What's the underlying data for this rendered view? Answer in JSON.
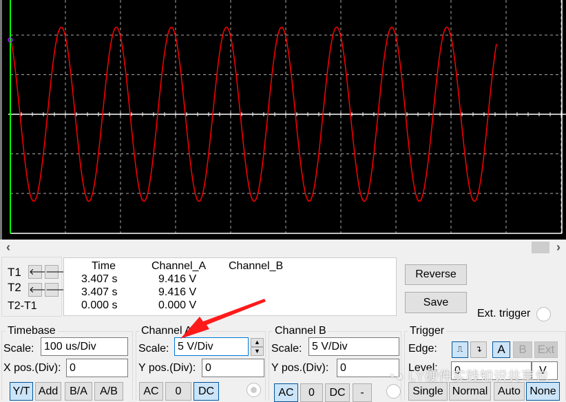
{
  "scope": {
    "trace_color": "#ff0000",
    "cursor_color": "#00ff00",
    "waveform": {
      "amplitude_v": 11,
      "frequency_hz": 10000,
      "offset_v": 0
    },
    "timebase_us_per_div": 100,
    "volts_per_div": 5
  },
  "scrollbar": {
    "left_icon": "chevron-left-icon",
    "right_icon": "chevron-right-icon"
  },
  "cursors": {
    "t1": "T1",
    "t2": "T2",
    "t2_t1": "T2-T1",
    "left_arrow": "🡐",
    "right_arrow": "🡒"
  },
  "readout": {
    "headers": [
      "Time",
      "Channel_A",
      "Channel_B"
    ],
    "rows": [
      [
        "3.407 s",
        "9.416 V",
        ""
      ],
      [
        "3.407 s",
        "9.416 V",
        ""
      ],
      [
        "0.000 s",
        "0.000 V",
        ""
      ]
    ]
  },
  "actions": {
    "reverse": "Reverse",
    "save": "Save",
    "ext_trigger": "Ext. trigger"
  },
  "timebase": {
    "title": "Timebase",
    "scale_label": "Scale:",
    "scale": "100 us/Div",
    "xpos_label": "X pos.(Div):",
    "xpos": "0",
    "modes": [
      "Y/T",
      "Add",
      "B/A",
      "A/B"
    ],
    "active_mode": "Y/T"
  },
  "channel_a": {
    "title": "Channel A",
    "scale_label": "Scale:",
    "scale": "5  V/Div",
    "ypos_label": "Y pos.(Div):",
    "ypos": "0",
    "coupling": [
      "AC",
      "0",
      "DC"
    ],
    "active": "DC"
  },
  "channel_b": {
    "title": "Channel B",
    "scale_label": "Scale:",
    "scale": "5  V/Div",
    "ypos_label": "Y pos.(Div):",
    "ypos": "0",
    "coupling": [
      "AC",
      "0",
      "DC",
      "-"
    ],
    "active": "AC"
  },
  "trigger": {
    "title": "Trigger",
    "edge_label": "Edge:",
    "rising": "rising-edge-icon",
    "falling": "falling-edge-icon",
    "sources": [
      "A",
      "B",
      "Ext"
    ],
    "level_label": "Level:",
    "level": "0",
    "level_unit": "V",
    "modes": [
      "Single",
      "Normal",
      "Auto",
      "None"
    ],
    "active_mode": "None"
  },
  "watermark": "LY硬件实践知识共享包"
}
